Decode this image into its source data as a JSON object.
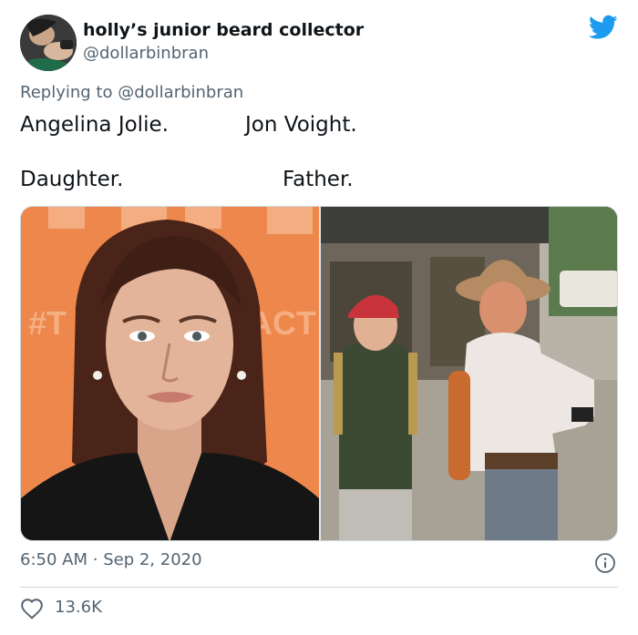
{
  "tweet": {
    "display_name": "holly’s junior beard collector",
    "handle": "@dollarbinbran",
    "replying_prefix": "Replying to",
    "replying_to": "@dollarbinbran",
    "text_left_1": "Angelina Jolie.",
    "text_right_1": "Jon Voight.",
    "text_left_2": "Daughter.",
    "text_right_2": "Father.",
    "time": "6:50 AM",
    "separator": "·",
    "date": "Sep 2, 2020",
    "likes": "13.6K"
  },
  "photos": {
    "left_backdrop_text": "ACT",
    "left_backdrop_text2": "#T"
  },
  "icons": {
    "logo": "twitter-bird-icon",
    "info": "info-icon",
    "like": "heart-icon"
  },
  "colors": {
    "brand": "#1d9bf0",
    "muted": "#536471",
    "text": "#0f1419",
    "divider": "#cfd9de"
  }
}
